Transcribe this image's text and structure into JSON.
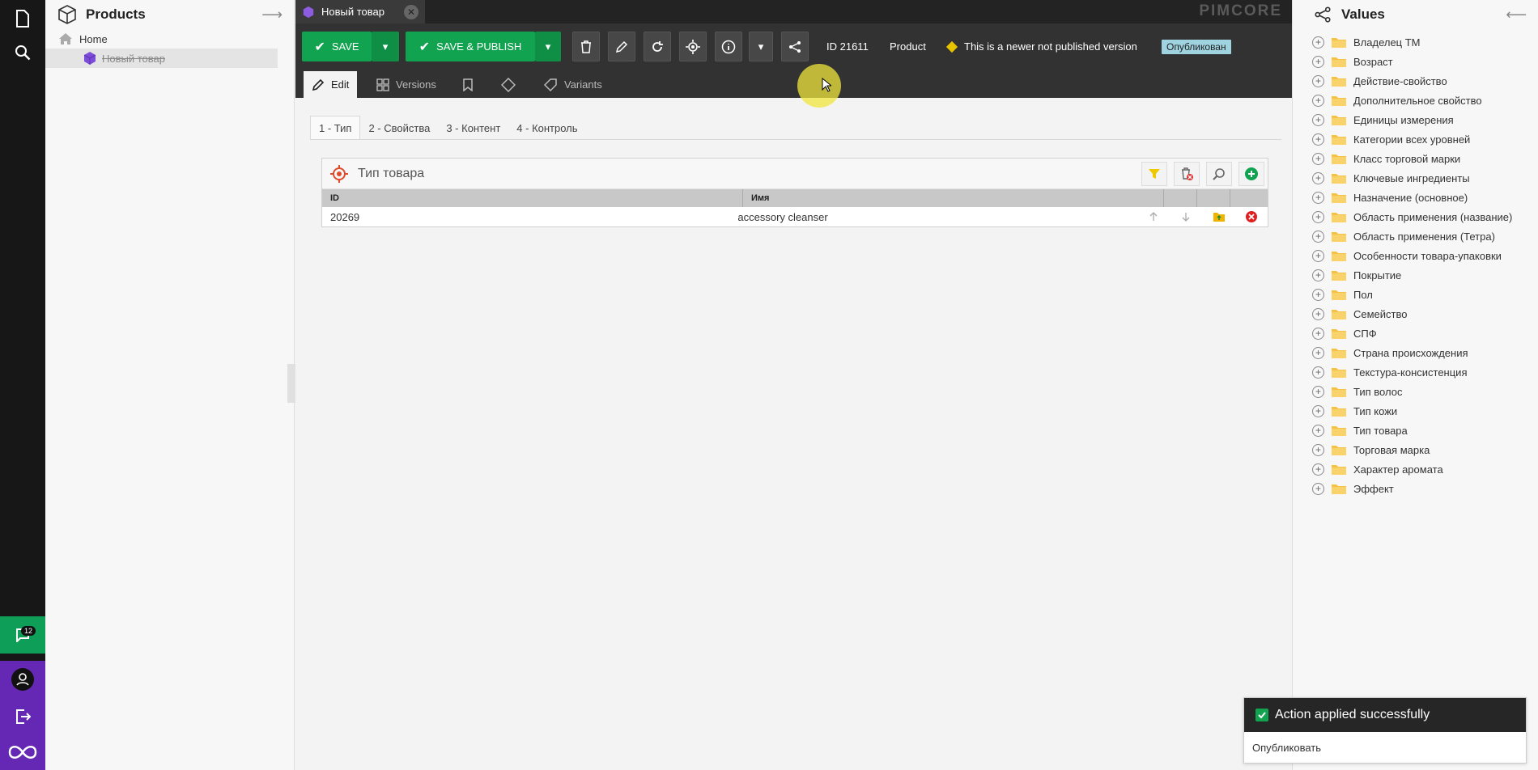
{
  "left_panel": {
    "title": "Products",
    "tree": [
      {
        "label": "Home"
      },
      {
        "label": "Новый товар"
      }
    ]
  },
  "rail": {
    "notifications_count": "12"
  },
  "document_tab": {
    "title": "Новый товар"
  },
  "brand": "PIMCORE",
  "toolbar": {
    "save_label": "SAVE",
    "save_publish_label": "SAVE & PUBLISH",
    "id_label": "ID 21611",
    "type_label": "Product",
    "version_notice": "This is a newer not published version",
    "published_badge": "Опубликован"
  },
  "subtabs": [
    {
      "label": "Edit"
    },
    {
      "label": "Versions"
    },
    {
      "label": "Variants"
    }
  ],
  "layout_tabs": [
    {
      "label": "1 - Тип"
    },
    {
      "label": "2 - Свойства"
    },
    {
      "label": "3 - Контент"
    },
    {
      "label": "4 - Контроль"
    }
  ],
  "relation": {
    "title": "Тип товара",
    "columns": [
      "ID",
      "Имя"
    ],
    "rows": [
      {
        "id": "20269",
        "name": "accessory cleanser"
      }
    ]
  },
  "right_panel": {
    "title": "Values",
    "items": [
      "Владелец ТМ",
      "Возраст",
      "Действие-свойство",
      "Дополнительное свойство",
      "Единицы измерения",
      "Категории всех уровней",
      "Класс торговой марки",
      "Ключевые ингредиенты",
      "Назначение (основное)",
      "Область применения (название)",
      "Область применения (Тетра)",
      "Особенности товара-упаковки",
      "Покрытие",
      "Пол",
      "Семейство",
      "СПФ",
      "Страна происхождения",
      "Текстура-консистенция",
      "Тип волос",
      "Тип кожи",
      "Тип товара",
      "Торговая марка",
      "Характер аромата",
      "Эффект"
    ]
  },
  "notification": {
    "title": "Action applied successfully",
    "message": "Опубликовать"
  },
  "colors": {
    "green": "#12a350",
    "purple": "#6428b4",
    "dark": "#323232"
  }
}
